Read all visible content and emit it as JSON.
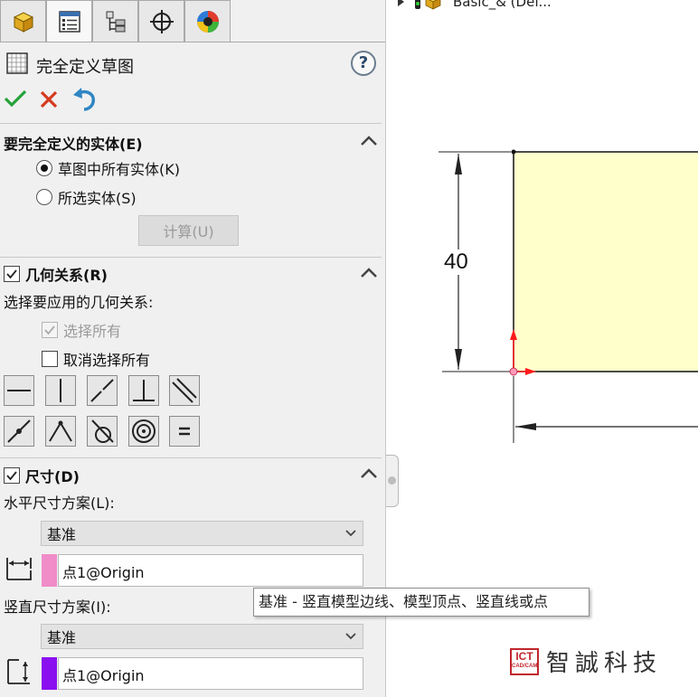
{
  "property_manager": {
    "tabs": [
      "feature-manager",
      "property-manager",
      "configuration-manager",
      "dimxpert-manager",
      "display-manager"
    ],
    "title": "完全定义草图",
    "help_label": "?",
    "actions": [
      "ok",
      "cancel",
      "undo"
    ],
    "entities_group": {
      "title": "要完全定义的实体(E)",
      "options": [
        {
          "label": "草图中所有实体(K)",
          "selected": true
        },
        {
          "label": "所选实体(S)",
          "selected": false
        }
      ],
      "calculate_label": "计算(U)"
    },
    "relations_group": {
      "title": "几何关系(R)",
      "checked": true,
      "prompt": "选择要应用的几何关系:",
      "select_all": "选择所有",
      "deselect_all": "取消选择所有",
      "relation_icons": [
        "horizontal",
        "vertical",
        "collinear",
        "perpendicular",
        "parallel",
        "midpoint",
        "coincident",
        "tangent",
        "concentric",
        "equal"
      ]
    },
    "dimensions_group": {
      "title": "尺寸(D)",
      "checked": true,
      "horizontal_label": "水平尺寸方案(L):",
      "horizontal_scheme": "基准",
      "horizontal_datum": "点1@Origin",
      "horizontal_color": "#f08cc8",
      "vertical_label": "竖直尺寸方案(I):",
      "vertical_scheme": "基准",
      "vertical_datum": "点1@Origin",
      "vertical_color": "#8a10f0"
    },
    "tooltip": "基准 - 竖直模型边线、模型顶点、竖直线或点"
  },
  "graphics": {
    "tree_item": "Basic_&  (Def...",
    "dimension_value": "40",
    "sketch_fill": "#ffffcc"
  },
  "watermark": {
    "logo_top": "ICT",
    "logo_bottom": "CAD/CAM",
    "company": "智誠科技"
  }
}
